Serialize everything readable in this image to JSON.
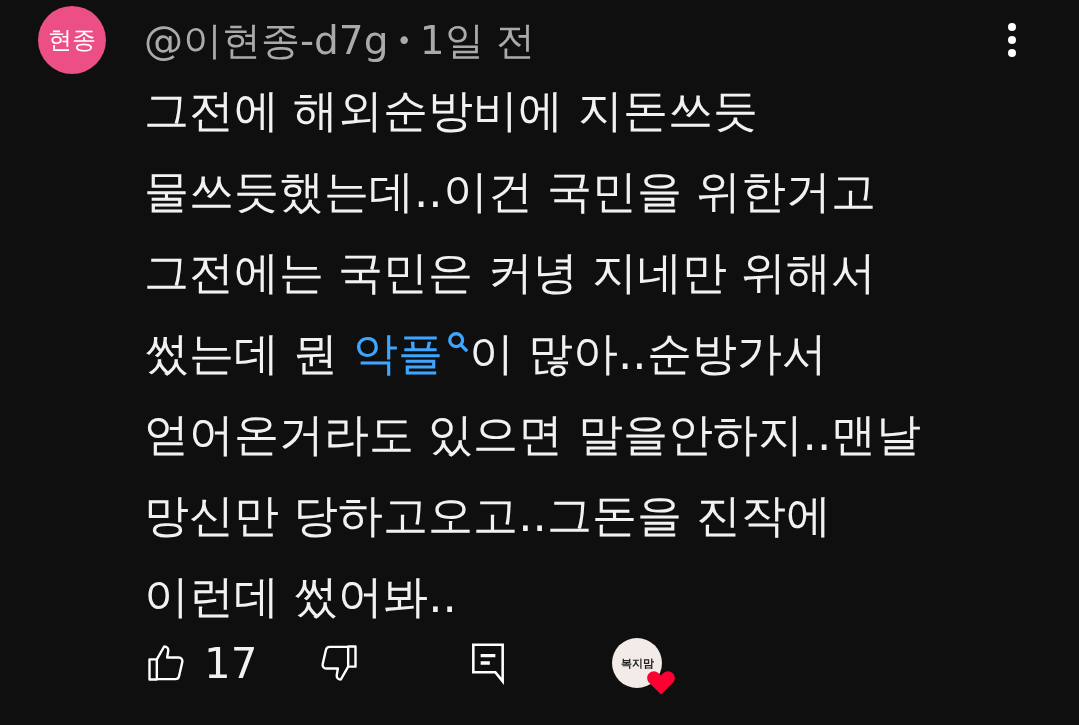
{
  "comment": {
    "avatar_text": "현종",
    "author": "@이현종-d7g",
    "separator": "•",
    "time": "1일 전",
    "body": {
      "before": "그전에 해외순방비에 지돈쓰듯\n물쓰듯했는데..이건 국민을 위한거고\n그전에는 국민은 커녕 지네만 위해서\n썼는데 뭔 ",
      "link": "악플",
      "after": "이 많아..순방가서\n얻어온거라도 있으면 말을안하지..맨날\n망신만 당하고오고..그돈을 진작에\n이런데 썼어봐.."
    },
    "likes": "17",
    "creator_heart": {
      "avatar_text": "복지맘",
      "hearted": true
    }
  }
}
